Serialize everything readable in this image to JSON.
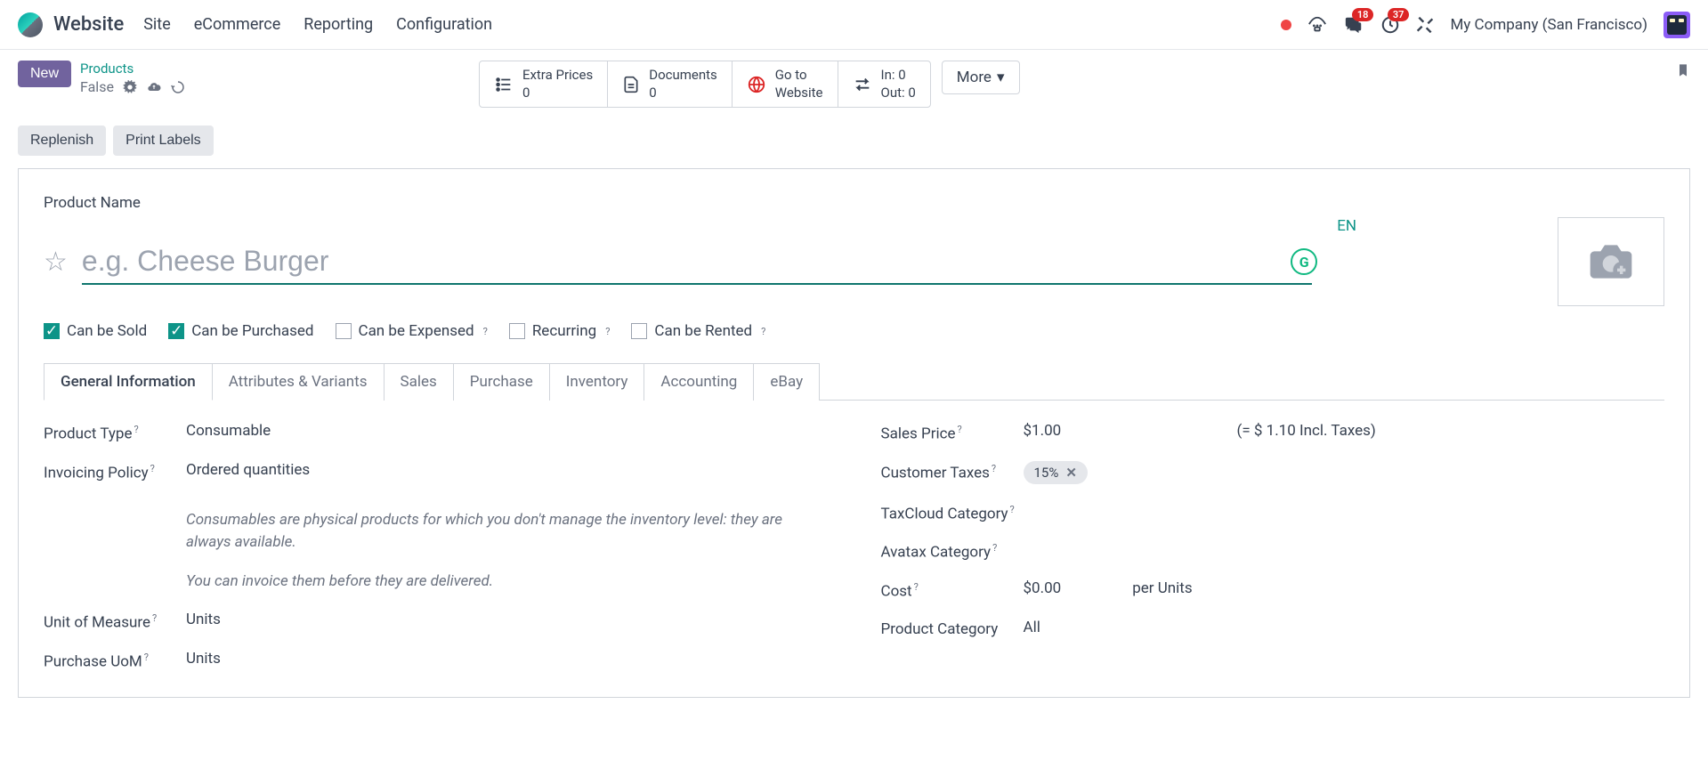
{
  "top": {
    "brand": "Website",
    "menu": [
      "Site",
      "eCommerce",
      "Reporting",
      "Configuration"
    ],
    "badges": {
      "chat": "18",
      "clock": "37"
    },
    "company": "My Company (San Francisco)"
  },
  "subbar": {
    "new_label": "New",
    "breadcrumb_link": "Products",
    "breadcrumb_value": "False",
    "stats": {
      "extra_prices": {
        "label": "Extra Prices",
        "value": "0"
      },
      "documents": {
        "label": "Documents",
        "value": "0"
      },
      "go_website": {
        "line1": "Go to",
        "line2": "Website"
      },
      "inventory": {
        "in": "In: 0",
        "out": "Out: 0"
      }
    },
    "more_label": "More"
  },
  "actions": {
    "replenish": "Replenish",
    "print_labels": "Print Labels"
  },
  "form": {
    "name_label": "Product Name",
    "name_placeholder": "e.g. Cheese Burger",
    "lang": "EN",
    "checks": {
      "sold": "Can be Sold",
      "purchased": "Can be Purchased",
      "expensed": "Can be Expensed",
      "recurring": "Recurring",
      "rented": "Can be Rented"
    },
    "tabs": [
      "General Information",
      "Attributes & Variants",
      "Sales",
      "Purchase",
      "Inventory",
      "Accounting",
      "eBay"
    ]
  },
  "general": {
    "left": {
      "product_type_label": "Product Type",
      "product_type_value": "Consumable",
      "invoicing_label": "Invoicing Policy",
      "invoicing_value": "Ordered quantities",
      "note1": "Consumables are physical products for which you don't manage the inventory level: they are always available.",
      "note2": "You can invoice them before they are delivered.",
      "uom_label": "Unit of Measure",
      "uom_value": "Units",
      "puom_label": "Purchase UoM",
      "puom_value": "Units"
    },
    "right": {
      "sales_price_label": "Sales Price",
      "sales_price_value": "$1.00",
      "sales_price_incl": "(= $ 1.10 Incl. Taxes)",
      "cust_tax_label": "Customer Taxes",
      "cust_tax_tag": "15%",
      "taxcloud_label": "TaxCloud Category",
      "avatax_label": "Avatax Category",
      "cost_label": "Cost",
      "cost_value": "$0.00",
      "cost_per": "per Units",
      "category_label": "Product Category",
      "category_value": "All"
    }
  }
}
